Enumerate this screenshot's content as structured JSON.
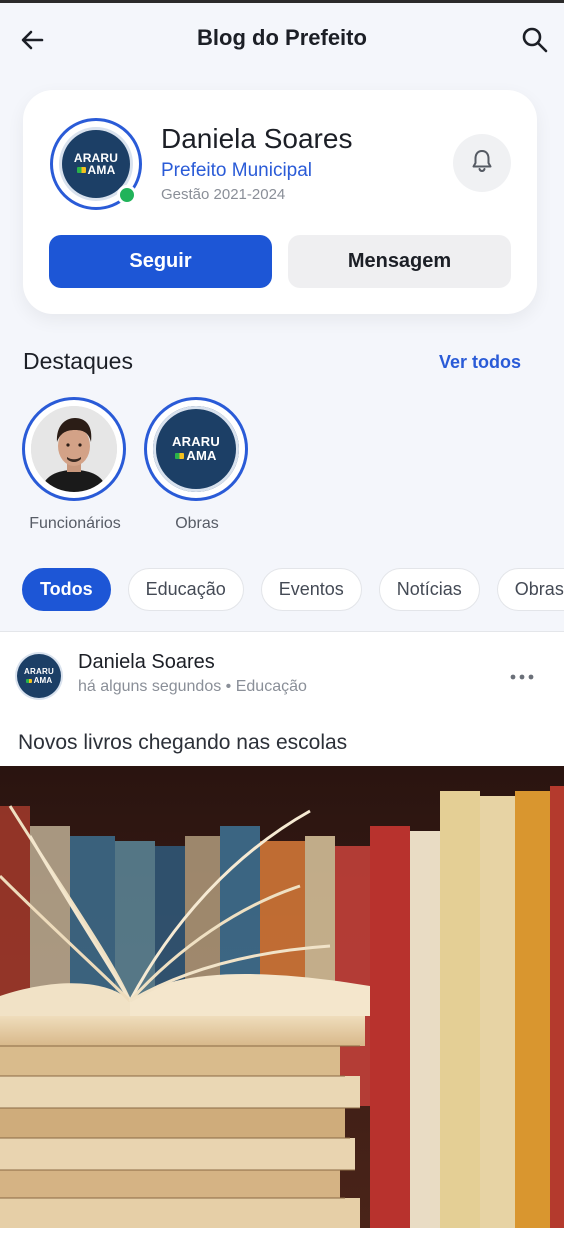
{
  "header": {
    "title": "Blog do Prefeito",
    "back_icon": "arrow-left-icon",
    "search_icon": "search-icon"
  },
  "profile": {
    "name": "Daniela Soares",
    "role": "Prefeito Municipal",
    "term": "Gestão 2021-2024",
    "logo_line1": "ARARU",
    "logo_line2": "AMA",
    "online": true,
    "follow_label": "Seguir",
    "message_label": "Mensagem",
    "bell_icon": "bell-icon"
  },
  "highlights": {
    "title": "Destaques",
    "see_all": "Ver todos",
    "items": [
      {
        "label": "Funcionários"
      },
      {
        "label": "Obras",
        "logo_line1": "ARARU",
        "logo_line2": "AMA"
      }
    ]
  },
  "filters": [
    "Todos",
    "Educação",
    "Eventos",
    "Notícias",
    "Obras"
  ],
  "active_filter": "Todos",
  "post": {
    "author": "Daniela Soares",
    "meta": "há alguns segundos • Educação",
    "text": "Novos livros chegando nas escolas",
    "more_icon": "more-horizontal-icon",
    "logo_line1": "ARARU",
    "logo_line2": "AMA"
  },
  "colors": {
    "primary": "#1d56d6",
    "background": "#f4f6fb",
    "online": "#21b35a",
    "logo_bg": "#1c3f66"
  }
}
